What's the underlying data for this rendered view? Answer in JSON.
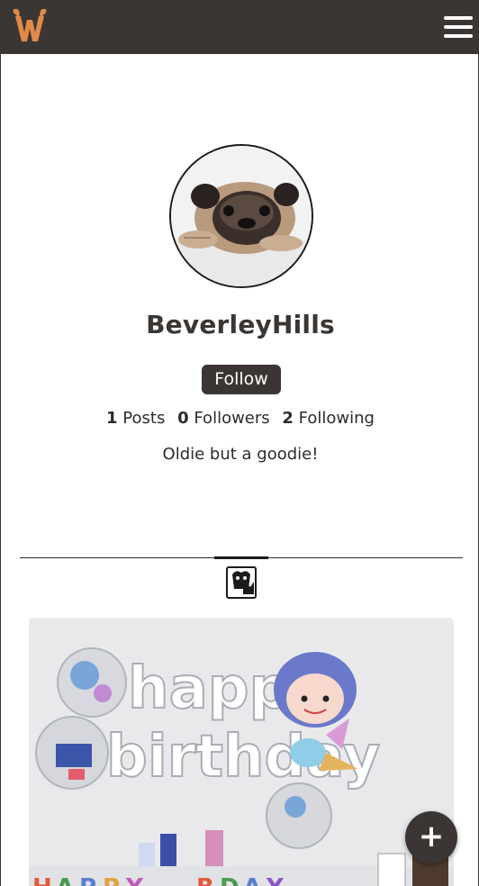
{
  "navbar": {
    "logo_icon": "wag-dog-ears-logo",
    "menu_icon": "hamburger-menu-icon"
  },
  "profile": {
    "avatar_icon": "pug-avatar-photo",
    "username": "BeverleyHills",
    "follow_label": "Follow",
    "stats": {
      "posts_count": "1",
      "posts_label": "Posts",
      "followers_count": "0",
      "followers_label": "Followers",
      "following_count": "2",
      "following_label": "Following"
    },
    "bio": "Oldie but a goodie!"
  },
  "tabs": {
    "posts_tab_icon": "dog-photo-icon"
  },
  "posts": [
    {
      "image_icon": "birthday-balloons-photo",
      "balloon_text": "happy birthday"
    }
  ],
  "fab": {
    "label": "+"
  },
  "colors": {
    "brand_dark": "#3b3633",
    "logo_orange": "#e08a4a",
    "background": "#ffffff"
  }
}
